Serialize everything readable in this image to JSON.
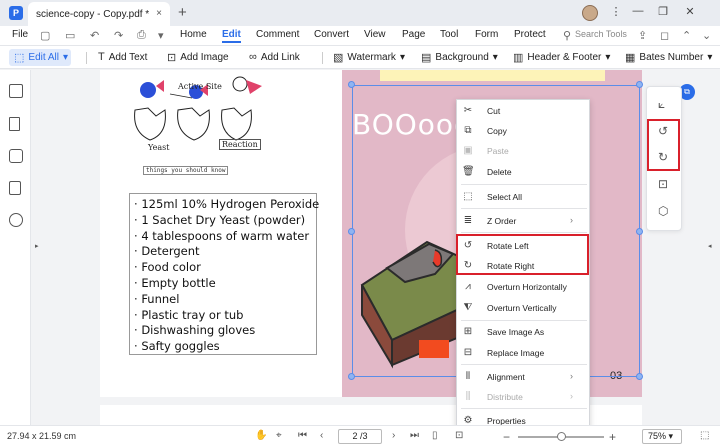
{
  "titlebar": {
    "tab_title": "science-copy - Copy.pdf *",
    "tab_close": "×",
    "new_tab": "+"
  },
  "menubar": {
    "file": "File",
    "items": [
      "Home",
      "Edit",
      "Comment",
      "Convert",
      "View",
      "Page",
      "Tool",
      "Form",
      "Protect"
    ],
    "active": "Edit",
    "search_tools": "Search Tools"
  },
  "toolbar": {
    "edit_all": "Edit All",
    "add_text": "Add Text",
    "add_image": "Add Image",
    "add_link": "Add Link",
    "watermark": "Watermark",
    "background": "Background",
    "header_footer": "Header & Footer",
    "bates_number": "Bates Number"
  },
  "document": {
    "diagram_labels": {
      "active_site": "Active Site",
      "yeast": "Yeast",
      "reaction": "Reaction",
      "caption": "things you should know"
    },
    "materials": [
      "125ml 10% Hydrogen Peroxide",
      "1 Sachet Dry Yeast (powder)",
      "4 tablespoons of warm water",
      "Detergent",
      "Food color",
      "Empty bottle",
      "Funnel",
      "Plastic tray or tub",
      "Dishwashing gloves",
      "Safty goggles"
    ],
    "art_text": "BOOooo",
    "page_number": "03"
  },
  "context_menu": {
    "items": [
      {
        "label": "Cut",
        "icon": "scissors-icon",
        "disabled": false
      },
      {
        "label": "Copy",
        "icon": "copy-icon",
        "disabled": false
      },
      {
        "label": "Paste",
        "icon": "paste-icon",
        "disabled": true
      },
      {
        "label": "Delete",
        "icon": "trash-icon",
        "disabled": false
      },
      {
        "label": "Select All",
        "icon": "select-all-icon",
        "disabled": false
      },
      {
        "label": "Z Order",
        "icon": "z-order-icon",
        "disabled": false
      },
      {
        "label": "Rotate Left",
        "icon": "rotate-left-icon",
        "disabled": false
      },
      {
        "label": "Rotate Right",
        "icon": "rotate-right-icon",
        "disabled": false
      },
      {
        "label": "Overturn Horizontally",
        "icon": "flip-horizontal-icon",
        "disabled": false
      },
      {
        "label": "Overturn Vertically",
        "icon": "flip-vertical-icon",
        "disabled": false
      },
      {
        "label": "Save Image As",
        "icon": "save-image-icon",
        "disabled": false
      },
      {
        "label": "Replace Image",
        "icon": "replace-image-icon",
        "disabled": false
      },
      {
        "label": "Alignment",
        "icon": "alignment-icon",
        "disabled": false
      },
      {
        "label": "Distribute",
        "icon": "distribute-icon",
        "disabled": true
      },
      {
        "label": "Properties",
        "icon": "properties-icon",
        "disabled": false
      }
    ],
    "submenu_arrow": "›"
  },
  "statusbar": {
    "page_size": "27.94 x 21.59 cm",
    "page_indicator": "2 /3",
    "zoom": "75%",
    "zoom_minus": "−",
    "zoom_plus": "+",
    "zoom_fraction": 0.5
  },
  "colors": {
    "accent": "#2b6de8",
    "highlight_box": "#d9202b",
    "page_art_bg": "#e2b8c7"
  }
}
